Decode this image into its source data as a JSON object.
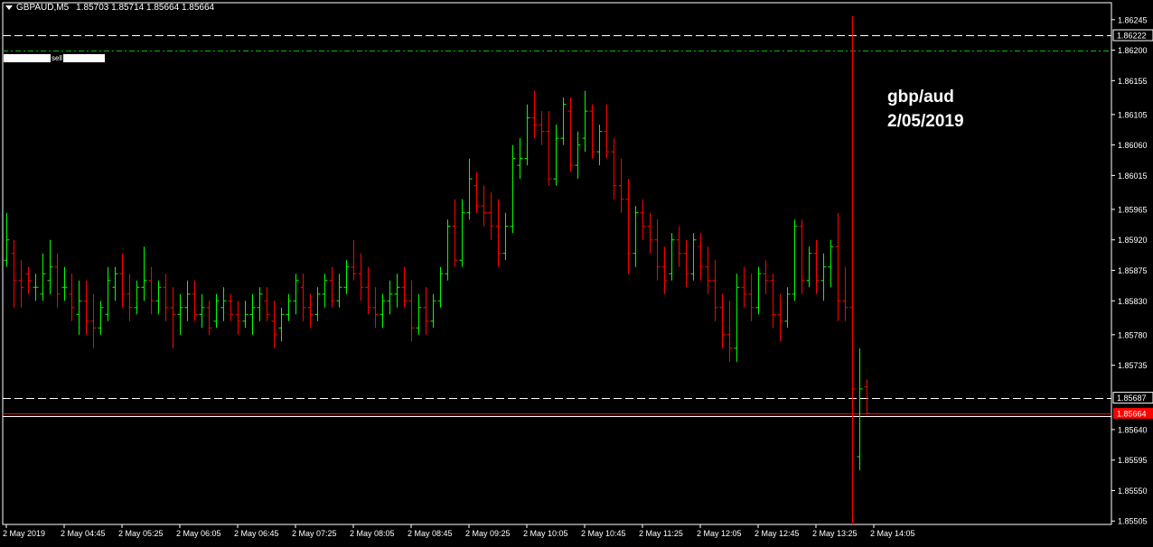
{
  "header": {
    "symbol": "GBPAUD,M5",
    "ohlc": "1.85703 1.85714 1.85664 1.85664"
  },
  "annotation": {
    "line1": "gbp/aud",
    "line2": "2/05/2019"
  },
  "order_label": {
    "text": "sell"
  },
  "colors": {
    "background": "#000000",
    "bull": "#00ff00",
    "bear": "#ff0000",
    "frame": "#ffffff",
    "sell_line": "#00c000",
    "price_tag": "#ff0000"
  },
  "chart_data": {
    "type": "bar",
    "style": "ohlc",
    "timeframe": "M5",
    "grid": false,
    "ylim": [
      1.855,
      1.8627
    ],
    "y_ticks": [
      "1.86245",
      "1.86200",
      "1.86155",
      "1.86105",
      "1.86060",
      "1.86015",
      "1.85965",
      "1.85920",
      "1.85875",
      "1.85830",
      "1.85780",
      "1.85735",
      "1.85640",
      "1.85595",
      "1.85550",
      "1.85505"
    ],
    "x_ticks": [
      {
        "label": "2 May 2019",
        "bar": 0
      },
      {
        "label": "2 May 04:45",
        "bar": 8
      },
      {
        "label": "2 May 05:25",
        "bar": 16
      },
      {
        "label": "2 May 06:05",
        "bar": 24
      },
      {
        "label": "2 May 06:45",
        "bar": 32
      },
      {
        "label": "2 May 07:25",
        "bar": 40
      },
      {
        "label": "2 May 08:05",
        "bar": 48
      },
      {
        "label": "2 May 08:45",
        "bar": 56
      },
      {
        "label": "2 May 09:25",
        "bar": 64
      },
      {
        "label": "2 May 10:05",
        "bar": 72
      },
      {
        "label": "2 May 10:45",
        "bar": 80
      },
      {
        "label": "2 May 11:25",
        "bar": 88
      },
      {
        "label": "2 May 12:05",
        "bar": 96
      },
      {
        "label": "2 May 12:45",
        "bar": 104
      },
      {
        "label": "2 May 13:25",
        "bar": 112
      },
      {
        "label": "2 May 14:05",
        "bar": 120
      }
    ],
    "bars": [
      [
        1.8589,
        1.8596,
        1.8588,
        1.8592
      ],
      [
        1.859,
        1.8592,
        1.8582,
        1.8586
      ],
      [
        1.8586,
        1.8589,
        1.8582,
        1.8585
      ],
      [
        1.8587,
        1.8588,
        1.8584,
        1.8586
      ],
      [
        1.8585,
        1.8587,
        1.8583,
        1.8585
      ],
      [
        1.8584,
        1.859,
        1.8583,
        1.8587
      ],
      [
        1.8586,
        1.8592,
        1.8584,
        1.8588
      ],
      [
        1.8588,
        1.859,
        1.8582,
        1.8584
      ],
      [
        1.8585,
        1.8588,
        1.8583,
        1.8585
      ],
      [
        1.8584,
        1.8587,
        1.858,
        1.8582
      ],
      [
        1.8581,
        1.8586,
        1.8578,
        1.8583
      ],
      [
        1.8583,
        1.8586,
        1.8578,
        1.858
      ],
      [
        1.858,
        1.8584,
        1.8576,
        1.8579
      ],
      [
        1.8579,
        1.8583,
        1.8578,
        1.8582
      ],
      [
        1.8581,
        1.8588,
        1.858,
        1.8586
      ],
      [
        1.8585,
        1.8588,
        1.8583,
        1.8587
      ],
      [
        1.8587,
        1.859,
        1.8582,
        1.8584
      ],
      [
        1.8584,
        1.8587,
        1.858,
        1.8582
      ],
      [
        1.8582,
        1.8586,
        1.8581,
        1.8585
      ],
      [
        1.8585,
        1.8591,
        1.8583,
        1.8586
      ],
      [
        1.8586,
        1.8588,
        1.8581,
        1.8583
      ],
      [
        1.8583,
        1.8586,
        1.8581,
        1.8585
      ],
      [
        1.8585,
        1.8587,
        1.858,
        1.8582
      ],
      [
        1.8582,
        1.8585,
        1.8576,
        1.8581
      ],
      [
        1.8581,
        1.8584,
        1.8578,
        1.8582
      ],
      [
        1.8582,
        1.8586,
        1.858,
        1.8584
      ],
      [
        1.8584,
        1.8586,
        1.858,
        1.8581
      ],
      [
        1.8581,
        1.8584,
        1.8579,
        1.8582
      ],
      [
        1.8582,
        1.8583,
        1.8578,
        1.8579
      ],
      [
        1.858,
        1.8584,
        1.8579,
        1.8583
      ],
      [
        1.8582,
        1.8585,
        1.858,
        1.8583
      ],
      [
        1.8583,
        1.8584,
        1.858,
        1.8581
      ],
      [
        1.8581,
        1.8583,
        1.8578,
        1.858
      ],
      [
        1.858,
        1.8583,
        1.8579,
        1.8581
      ],
      [
        1.8581,
        1.8584,
        1.8578,
        1.8582
      ],
      [
        1.8582,
        1.8585,
        1.858,
        1.8584
      ],
      [
        1.8583,
        1.8585,
        1.858,
        1.8581
      ],
      [
        1.858,
        1.8583,
        1.8576,
        1.8578
      ],
      [
        1.8579,
        1.8582,
        1.8577,
        1.8581
      ],
      [
        1.8581,
        1.8584,
        1.858,
        1.8583
      ],
      [
        1.8583,
        1.8587,
        1.8581,
        1.8586
      ],
      [
        1.8585,
        1.8587,
        1.858,
        1.8582
      ],
      [
        1.8582,
        1.8584,
        1.8579,
        1.8581
      ],
      [
        1.8581,
        1.8585,
        1.858,
        1.8584
      ],
      [
        1.8584,
        1.8587,
        1.8582,
        1.8586
      ],
      [
        1.8586,
        1.8588,
        1.8582,
        1.8583
      ],
      [
        1.8583,
        1.8587,
        1.8582,
        1.8585
      ],
      [
        1.8585,
        1.8589,
        1.8584,
        1.8588
      ],
      [
        1.8588,
        1.8592,
        1.8586,
        1.8587
      ],
      [
        1.8587,
        1.859,
        1.8583,
        1.8585
      ],
      [
        1.8585,
        1.8588,
        1.8581,
        1.8582
      ],
      [
        1.8582,
        1.8585,
        1.8579,
        1.8581
      ],
      [
        1.8581,
        1.8584,
        1.8579,
        1.8583
      ],
      [
        1.8583,
        1.8586,
        1.8581,
        1.8584
      ],
      [
        1.8584,
        1.8587,
        1.8582,
        1.8585
      ],
      [
        1.8585,
        1.8588,
        1.8582,
        1.8583
      ],
      [
        1.8583,
        1.8586,
        1.8577,
        1.8579
      ],
      [
        1.8579,
        1.8584,
        1.8578,
        1.8582
      ],
      [
        1.8582,
        1.8585,
        1.8578,
        1.858
      ],
      [
        1.858,
        1.8584,
        1.8579,
        1.8583
      ],
      [
        1.8583,
        1.8588,
        1.8582,
        1.8587
      ],
      [
        1.8587,
        1.8595,
        1.8586,
        1.8594
      ],
      [
        1.8594,
        1.8598,
        1.8588,
        1.8589
      ],
      [
        1.8589,
        1.8598,
        1.8588,
        1.8596
      ],
      [
        1.8596,
        1.8604,
        1.8595,
        1.8601
      ],
      [
        1.86,
        1.8602,
        1.8596,
        1.8597
      ],
      [
        1.8597,
        1.86,
        1.8594,
        1.8596
      ],
      [
        1.8596,
        1.8599,
        1.8592,
        1.8594
      ],
      [
        1.8594,
        1.8598,
        1.8588,
        1.859
      ],
      [
        1.859,
        1.8596,
        1.8589,
        1.8594
      ],
      [
        1.8594,
        1.8606,
        1.8593,
        1.8604
      ],
      [
        1.8603,
        1.8607,
        1.8601,
        1.8604
      ],
      [
        1.8604,
        1.8612,
        1.8603,
        1.861
      ],
      [
        1.861,
        1.8614,
        1.8607,
        1.8609
      ],
      [
        1.8609,
        1.8611,
        1.8606,
        1.8608
      ],
      [
        1.8608,
        1.8611,
        1.86,
        1.8601
      ],
      [
        1.8601,
        1.8609,
        1.86,
        1.8607
      ],
      [
        1.8607,
        1.8613,
        1.8606,
        1.8612
      ],
      [
        1.8611,
        1.8613,
        1.8602,
        1.8603
      ],
      [
        1.8603,
        1.8608,
        1.8601,
        1.8606
      ],
      [
        1.8607,
        1.8614,
        1.8605,
        1.8611
      ],
      [
        1.8611,
        1.8612,
        1.8604,
        1.8605
      ],
      [
        1.8605,
        1.8609,
        1.8603,
        1.8608
      ],
      [
        1.8608,
        1.8612,
        1.8604,
        1.8605
      ],
      [
        1.8605,
        1.8607,
        1.8598,
        1.86
      ],
      [
        1.86,
        1.8604,
        1.8596,
        1.8598
      ],
      [
        1.8598,
        1.8601,
        1.8587,
        1.859
      ],
      [
        1.859,
        1.8597,
        1.8588,
        1.8596
      ],
      [
        1.8596,
        1.8598,
        1.8592,
        1.8594
      ],
      [
        1.8594,
        1.8596,
        1.859,
        1.8592
      ],
      [
        1.8592,
        1.8595,
        1.8586,
        1.8588
      ],
      [
        1.8588,
        1.8591,
        1.8584,
        1.8586
      ],
      [
        1.8587,
        1.8593,
        1.8586,
        1.8592
      ],
      [
        1.8592,
        1.8594,
        1.8588,
        1.859
      ],
      [
        1.859,
        1.8592,
        1.8585,
        1.8587
      ],
      [
        1.8587,
        1.8593,
        1.8586,
        1.8592
      ],
      [
        1.8591,
        1.8593,
        1.8586,
        1.8588
      ],
      [
        1.8588,
        1.8591,
        1.8584,
        1.8586
      ],
      [
        1.8586,
        1.8589,
        1.858,
        1.8582
      ],
      [
        1.8582,
        1.8584,
        1.8576,
        1.8578
      ],
      [
        1.8578,
        1.8583,
        1.8574,
        1.8576
      ],
      [
        1.8576,
        1.8587,
        1.8574,
        1.8585
      ],
      [
        1.8585,
        1.8588,
        1.8582,
        1.8584
      ],
      [
        1.8584,
        1.8587,
        1.858,
        1.8582
      ],
      [
        1.8582,
        1.8588,
        1.8581,
        1.8587
      ],
      [
        1.8587,
        1.8589,
        1.8584,
        1.8586
      ],
      [
        1.8586,
        1.8587,
        1.8579,
        1.8581
      ],
      [
        1.8581,
        1.8584,
        1.8577,
        1.858
      ],
      [
        1.858,
        1.8585,
        1.8579,
        1.8584
      ],
      [
        1.8584,
        1.8595,
        1.8583,
        1.8594
      ],
      [
        1.8594,
        1.8595,
        1.8584,
        1.8586
      ],
      [
        1.8586,
        1.8591,
        1.8585,
        1.859
      ],
      [
        1.859,
        1.8592,
        1.8584,
        1.8586
      ],
      [
        1.8586,
        1.859,
        1.8583,
        1.8588
      ],
      [
        1.8588,
        1.8592,
        1.8585,
        1.8591
      ],
      [
        1.8591,
        1.8596,
        1.858,
        1.8583
      ],
      [
        1.8583,
        1.8588,
        1.858,
        1.8582
      ],
      [
        1.8582,
        1.8625,
        1.855,
        1.857
      ],
      [
        1.856,
        1.8576,
        1.8558,
        1.857
      ],
      [
        1.85703,
        1.85714,
        1.85664,
        1.85664
      ]
    ],
    "lines": [
      {
        "name": "upper-dashed",
        "price": 1.86222,
        "style": "dashed",
        "color": "#ffffff",
        "label": "1.86222"
      },
      {
        "name": "sell-line",
        "price": 1.862,
        "style": "dashdot",
        "color": "#00c000"
      },
      {
        "name": "lower-dashed",
        "price": 1.85687,
        "style": "dashed",
        "color": "#ffffff",
        "label": "1.85687"
      },
      {
        "name": "bid-line",
        "price": 1.85664,
        "style": "solid",
        "color": "#ff0000",
        "label": "1.85664"
      },
      {
        "name": "ask-line",
        "price": 1.8566,
        "style": "solid",
        "color": "#ffffff"
      }
    ],
    "vline": {
      "bar": 117,
      "color": "#ff0000"
    }
  }
}
